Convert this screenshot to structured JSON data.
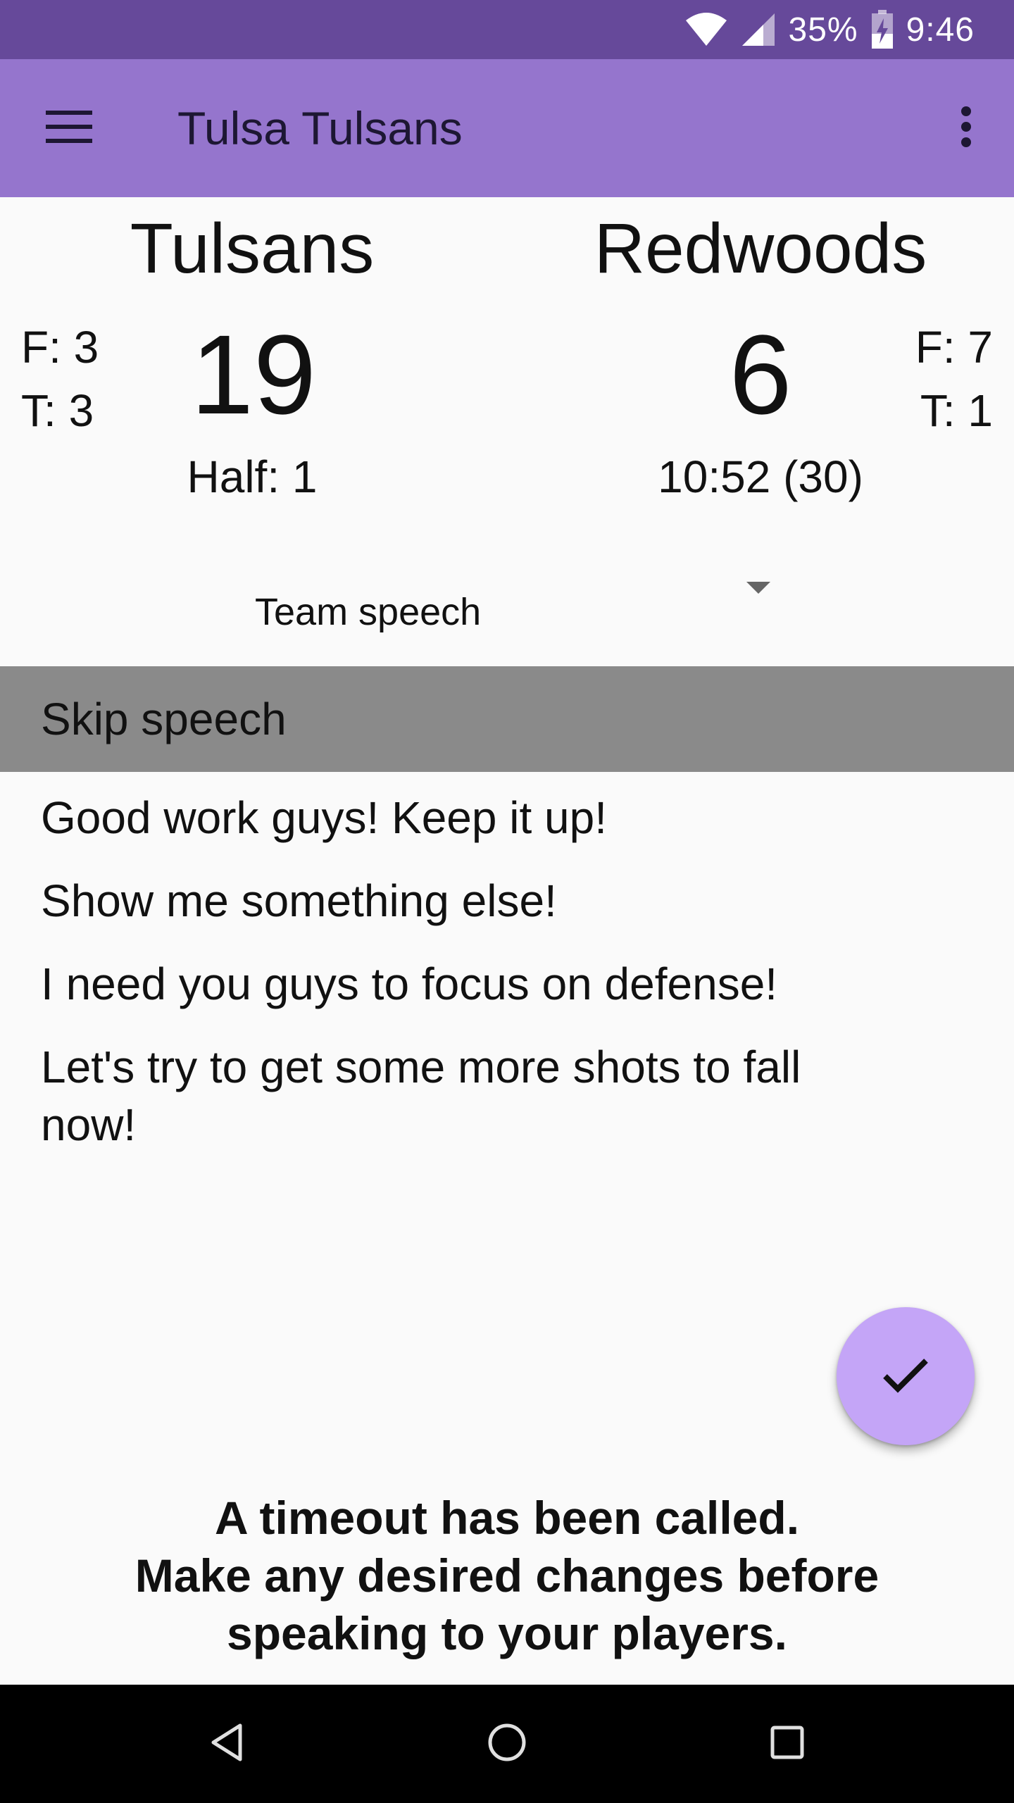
{
  "status_bar": {
    "battery_percent": "35%",
    "time": "9:46",
    "icons": [
      "wifi-icon",
      "cell-signal-icon",
      "battery-charging-icon"
    ],
    "background": "#66499a"
  },
  "app_bar": {
    "title": "Tulsa Tulsans",
    "background": "#9575cd",
    "icons": [
      "menu-icon",
      "overflow-menu-icon"
    ]
  },
  "scoreboard": {
    "home": {
      "name": "Tulsans",
      "score": "19",
      "fouls": "F: 3",
      "timeouts": "T: 3",
      "info": "Half: 1"
    },
    "away": {
      "name": "Redwoods",
      "score": "6",
      "fouls": "F: 7",
      "timeouts": "T: 1",
      "info": "10:52 (30)"
    }
  },
  "speech_select": {
    "selected": "Team speech"
  },
  "speech_options": [
    "Skip speech",
    "Good work guys! Keep it up!",
    "Show me something else!",
    "I need you guys to focus on defense!",
    "Let's try to get some more shots to fall now!"
  ],
  "fab": {
    "icon": "check-icon",
    "color": "#c4a5f7"
  },
  "message": {
    "line1": "A timeout has been called.",
    "line2": "Make any desired changes before",
    "line3": "speaking to your players."
  },
  "nav_bar": {
    "icons": [
      "back-icon",
      "home-icon",
      "recents-icon"
    ]
  }
}
